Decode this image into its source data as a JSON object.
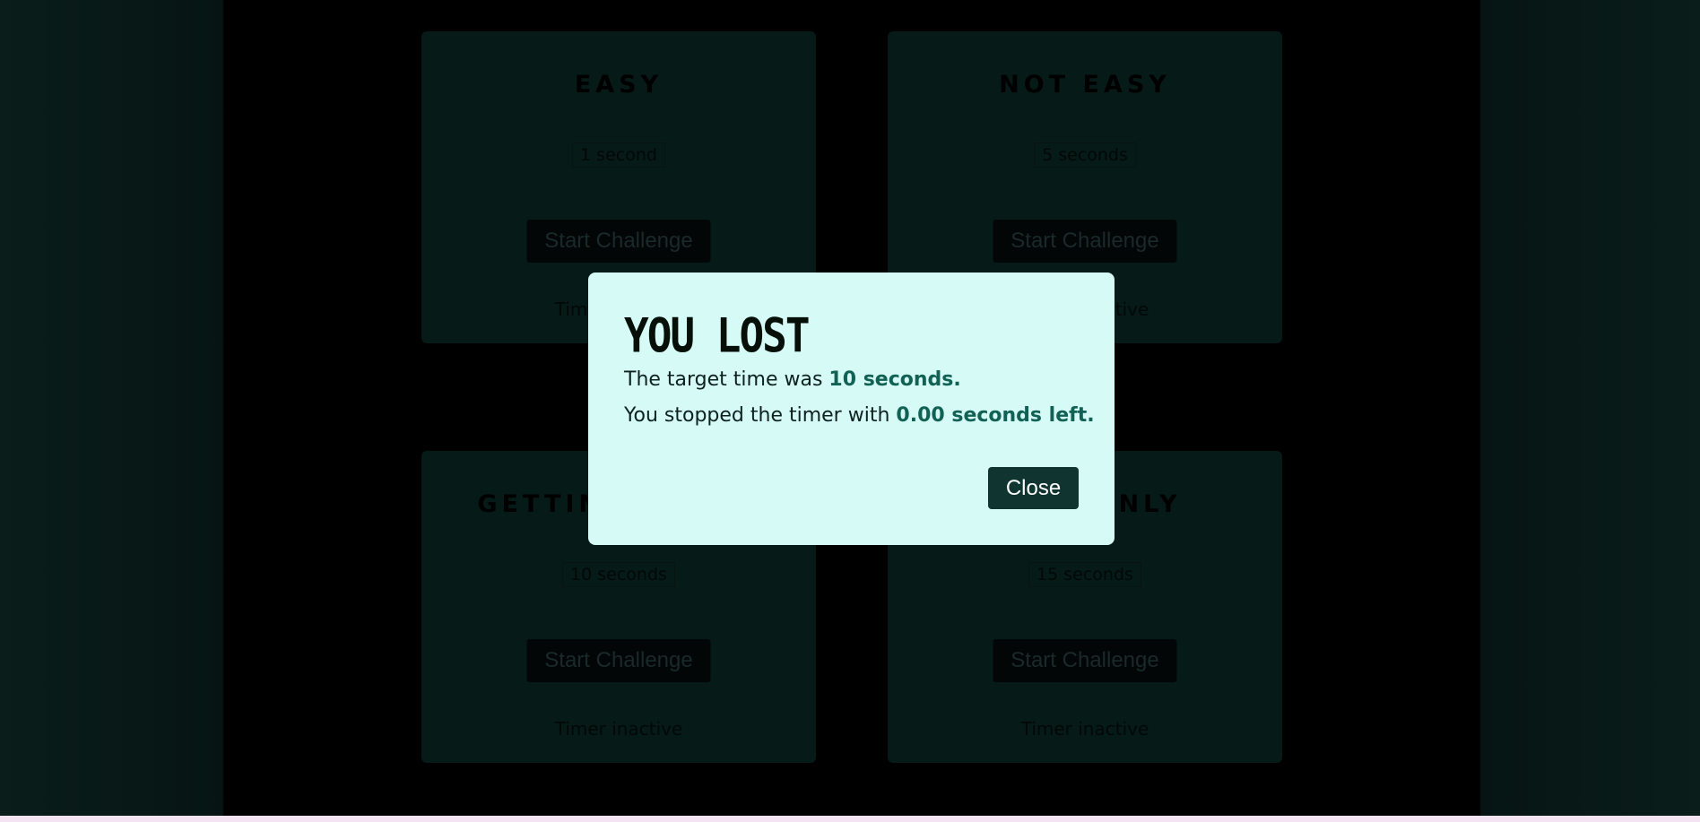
{
  "challenges": [
    {
      "title": "EASY",
      "duration": "1 second",
      "button_label": "Start Challenge",
      "status": "Timer inactive"
    },
    {
      "title": "NOT EASY",
      "duration": "5 seconds",
      "button_label": "Start Challenge",
      "status": "Timer inactive"
    },
    {
      "title": "GETTING TOUGH",
      "duration": "10 seconds",
      "button_label": "Start Challenge",
      "status": "Timer inactive"
    },
    {
      "title": "PROS ONLY",
      "duration": "15 seconds",
      "button_label": "Start Challenge",
      "status": "Timer inactive"
    }
  ],
  "result_modal": {
    "title": "YOU LOST",
    "target_prefix": "The target time was ",
    "target_value": "10 seconds.",
    "remaining_prefix": "You stopped the timer with ",
    "remaining_value": "0.00 seconds left.",
    "close_label": "Close"
  },
  "colors": {
    "modal_background": "#d6faf6",
    "accent": "#126155",
    "button_background": "#103530"
  }
}
